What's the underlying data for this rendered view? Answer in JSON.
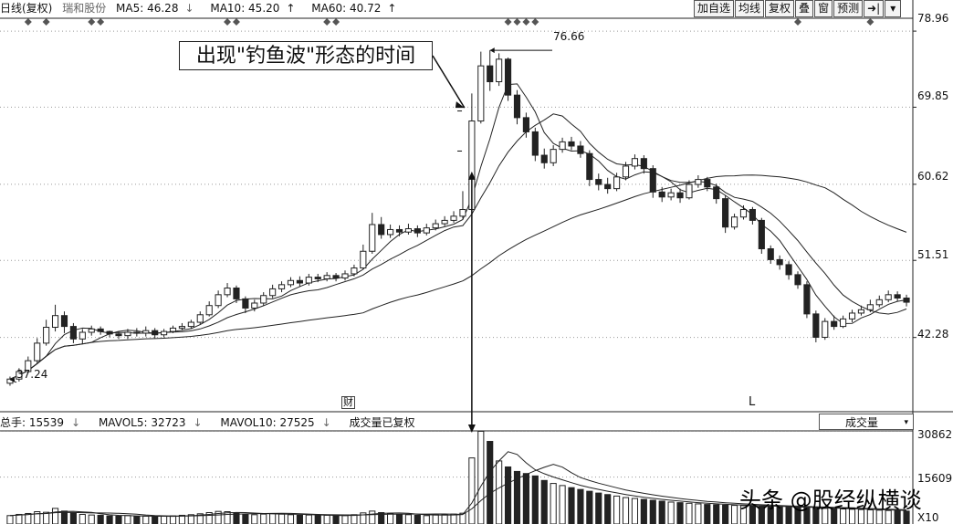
{
  "header": {
    "period": "日线(复权)",
    "stock": "瑞和股份",
    "ma5": "MA5: 46.28",
    "ma5_dir": "↓",
    "ma10": "MA10: 45.20",
    "ma10_dir": "↑",
    "ma60": "MA60: 40.72",
    "ma60_dir": "↑"
  },
  "toolbar": {
    "buttons": [
      "加自选",
      "均线",
      "复权",
      "叠",
      "窗",
      "预测",
      "➜|",
      "▾"
    ]
  },
  "volume_header": {
    "total": "总手: 15539",
    "total_dir": "↓",
    "mavol5": "MAVOL5: 32723",
    "mavol5_dir": "↓",
    "mavol10": "MAVOL10: 27525",
    "mavol10_dir": "↓",
    "note": "成交量已复权",
    "select": "成交量",
    "select_arrow": "▾"
  },
  "annotations": {
    "box": "出现\"钓鱼波\"形态的时间",
    "high": "76.66",
    "low": "37.24",
    "cai": "财",
    "l_mark": "L",
    "watermark": "头条 @股经纵横谈"
  },
  "chart_data": {
    "type": "candlestick",
    "price_axis": {
      "ticks": [
        "78.96",
        "69.85",
        "60.62",
        "51.51",
        "42.28"
      ],
      "tick_values": [
        78.96,
        69.85,
        60.62,
        51.51,
        42.28
      ],
      "ylim": [
        33.5,
        80.5
      ]
    },
    "volume_axis": {
      "ticks": [
        "30862",
        "15609",
        "X10"
      ],
      "tick_values": [
        30862,
        15609
      ],
      "ylim": [
        0,
        31000
      ]
    },
    "high_point": 76.66,
    "low_point": 37.24,
    "colors": {
      "up": "#ffffff",
      "down": "#222222",
      "line": "#222222",
      "grid": "#9a9a9a"
    },
    "candles": [
      [
        36.8,
        37.3,
        36.5,
        37.6
      ],
      [
        37.3,
        38.2,
        37.0,
        38.6
      ],
      [
        38.2,
        39.5,
        38.0,
        40.0
      ],
      [
        39.5,
        41.6,
        39.2,
        42.2
      ],
      [
        41.6,
        43.5,
        41.3,
        44.4
      ],
      [
        43.5,
        44.9,
        43.0,
        46.2
      ],
      [
        44.9,
        43.6,
        42.8,
        45.4
      ],
      [
        43.6,
        42.1,
        41.6,
        44.0
      ],
      [
        42.1,
        42.9,
        41.5,
        43.3
      ],
      [
        42.9,
        43.3,
        42.5,
        43.7
      ],
      [
        43.3,
        43.0,
        42.6,
        43.6
      ],
      [
        43.0,
        42.7,
        42.3,
        43.1
      ],
      [
        42.7,
        42.5,
        42.1,
        43.0
      ],
      [
        42.5,
        42.9,
        42.1,
        43.3
      ],
      [
        42.9,
        42.8,
        42.4,
        43.4
      ],
      [
        42.8,
        43.1,
        42.4,
        43.6
      ],
      [
        43.1,
        42.6,
        42.2,
        43.4
      ],
      [
        42.6,
        43.0,
        42.3,
        43.3
      ],
      [
        43.0,
        43.4,
        42.8,
        43.7
      ],
      [
        43.4,
        43.6,
        43.1,
        44.0
      ],
      [
        43.6,
        44.1,
        43.3,
        44.4
      ],
      [
        44.1,
        45.0,
        43.8,
        45.4
      ],
      [
        45.0,
        46.1,
        44.8,
        46.6
      ],
      [
        46.1,
        47.4,
        45.8,
        47.9
      ],
      [
        47.4,
        48.2,
        47.1,
        48.8
      ],
      [
        48.2,
        46.9,
        46.4,
        48.5
      ],
      [
        46.9,
        45.8,
        45.2,
        47.2
      ],
      [
        45.8,
        46.4,
        45.4,
        46.8
      ],
      [
        46.4,
        47.3,
        46.1,
        47.7
      ],
      [
        47.3,
        48.1,
        47.0,
        48.6
      ],
      [
        48.1,
        48.6,
        47.7,
        49.0
      ],
      [
        48.6,
        49.1,
        48.3,
        49.5
      ],
      [
        49.1,
        48.8,
        48.4,
        49.6
      ],
      [
        48.8,
        49.5,
        48.5,
        49.9
      ],
      [
        49.5,
        49.3,
        48.9,
        49.9
      ],
      [
        49.3,
        49.7,
        49.0,
        50.1
      ],
      [
        49.7,
        49.4,
        49.0,
        50.0
      ],
      [
        49.4,
        49.9,
        49.1,
        50.3
      ],
      [
        49.9,
        50.6,
        49.6,
        51.0
      ],
      [
        50.6,
        52.6,
        50.4,
        53.4
      ],
      [
        52.6,
        55.8,
        52.3,
        57.2
      ],
      [
        55.8,
        54.6,
        54.1,
        56.7
      ],
      [
        54.6,
        55.2,
        54.2,
        55.8
      ],
      [
        55.2,
        54.9,
        54.4,
        55.7
      ],
      [
        54.9,
        55.3,
        54.6,
        55.9
      ],
      [
        55.3,
        54.8,
        54.3,
        55.7
      ],
      [
        54.8,
        55.4,
        54.5,
        55.9
      ],
      [
        55.4,
        55.9,
        55.1,
        56.4
      ],
      [
        55.9,
        56.3,
        55.6,
        56.8
      ],
      [
        56.3,
        56.8,
        56.0,
        57.4
      ],
      [
        56.8,
        57.6,
        56.5,
        59.8
      ],
      [
        57.6,
        68.2,
        57.4,
        71.5
      ],
      [
        68.2,
        74.8,
        67.9,
        76.5
      ],
      [
        74.8,
        72.9,
        71.8,
        76.66
      ],
      [
        72.9,
        75.6,
        72.4,
        76.3
      ],
      [
        75.6,
        71.3,
        70.6,
        75.8
      ],
      [
        71.3,
        68.6,
        67.8,
        71.9
      ],
      [
        68.6,
        66.9,
        66.2,
        69.2
      ],
      [
        66.9,
        64.1,
        63.4,
        67.4
      ],
      [
        64.1,
        63.2,
        62.5,
        64.9
      ],
      [
        63.2,
        64.8,
        62.8,
        65.3
      ],
      [
        64.8,
        65.7,
        64.4,
        66.2
      ],
      [
        65.7,
        65.2,
        64.7,
        66.3
      ],
      [
        65.2,
        64.3,
        63.8,
        65.8
      ],
      [
        64.3,
        61.2,
        60.4,
        64.7
      ],
      [
        61.2,
        60.6,
        59.9,
        61.9
      ],
      [
        60.6,
        60.1,
        59.5,
        61.4
      ],
      [
        60.1,
        61.5,
        59.8,
        62.0
      ],
      [
        61.5,
        62.8,
        61.1,
        63.3
      ],
      [
        62.8,
        63.7,
        62.4,
        64.2
      ],
      [
        63.7,
        62.5,
        61.9,
        64.1
      ],
      [
        62.5,
        59.7,
        59.0,
        62.9
      ],
      [
        59.7,
        59.1,
        58.5,
        60.3
      ],
      [
        59.1,
        59.6,
        58.7,
        60.1
      ],
      [
        59.6,
        59.0,
        58.4,
        60.1
      ],
      [
        59.0,
        60.6,
        58.8,
        61.1
      ],
      [
        60.6,
        61.2,
        60.2,
        61.7
      ],
      [
        61.2,
        60.3,
        59.8,
        61.5
      ],
      [
        60.3,
        58.9,
        58.3,
        60.7
      ],
      [
        58.9,
        55.5,
        54.8,
        59.3
      ],
      [
        55.5,
        56.7,
        55.2,
        57.1
      ],
      [
        56.7,
        57.6,
        56.4,
        58.1
      ],
      [
        57.6,
        56.3,
        55.8,
        57.9
      ],
      [
        56.3,
        52.9,
        52.3,
        56.6
      ],
      [
        52.9,
        51.6,
        51.1,
        53.3
      ],
      [
        51.6,
        51.0,
        50.4,
        52.1
      ],
      [
        51.0,
        49.8,
        49.2,
        51.4
      ],
      [
        49.8,
        48.6,
        48.1,
        50.2
      ],
      [
        48.6,
        45.1,
        44.6,
        49.0
      ],
      [
        45.1,
        42.3,
        41.7,
        45.5
      ],
      [
        42.3,
        44.2,
        42.0,
        44.6
      ],
      [
        44.2,
        43.6,
        43.2,
        44.9
      ],
      [
        43.6,
        44.5,
        43.4,
        44.9
      ],
      [
        44.5,
        45.2,
        44.1,
        45.6
      ],
      [
        45.2,
        45.6,
        44.9,
        46.1
      ],
      [
        45.6,
        46.2,
        45.3,
        46.8
      ],
      [
        46.2,
        46.8,
        45.9,
        47.3
      ],
      [
        46.8,
        47.4,
        46.5,
        47.9
      ],
      [
        47.4,
        47.0,
        46.6,
        47.8
      ],
      [
        47.0,
        46.5,
        46.0,
        47.4
      ]
    ],
    "volumes": [
      2800,
      3200,
      3500,
      4100,
      3900,
      5200,
      4300,
      3600,
      3200,
      3000,
      2900,
      2700,
      2600,
      2800,
      2500,
      2600,
      2400,
      2600,
      2700,
      2900,
      3100,
      3400,
      3800,
      4200,
      4100,
      3600,
      3300,
      3100,
      3300,
      3500,
      3300,
      3100,
      2900,
      3000,
      2800,
      2900,
      2700,
      2800,
      3100,
      3700,
      4300,
      3800,
      3400,
      3200,
      3100,
      2900,
      2800,
      3000,
      3100,
      3300,
      3600,
      22000,
      30862,
      27500,
      21000,
      19000,
      17500,
      16800,
      16000,
      14500,
      13500,
      12800,
      12100,
      11500,
      10900,
      10300,
      9800,
      9300,
      8800,
      8500,
      8200,
      7900,
      7600,
      7300,
      7100,
      6900,
      6700,
      6500,
      6400,
      6300,
      6200,
      6100,
      6000,
      5900,
      5800,
      5700,
      5600,
      5500,
      5400,
      5300,
      5200,
      5100,
      5000,
      4900,
      4800,
      4700,
      4600,
      4500,
      4400,
      4300
    ]
  }
}
